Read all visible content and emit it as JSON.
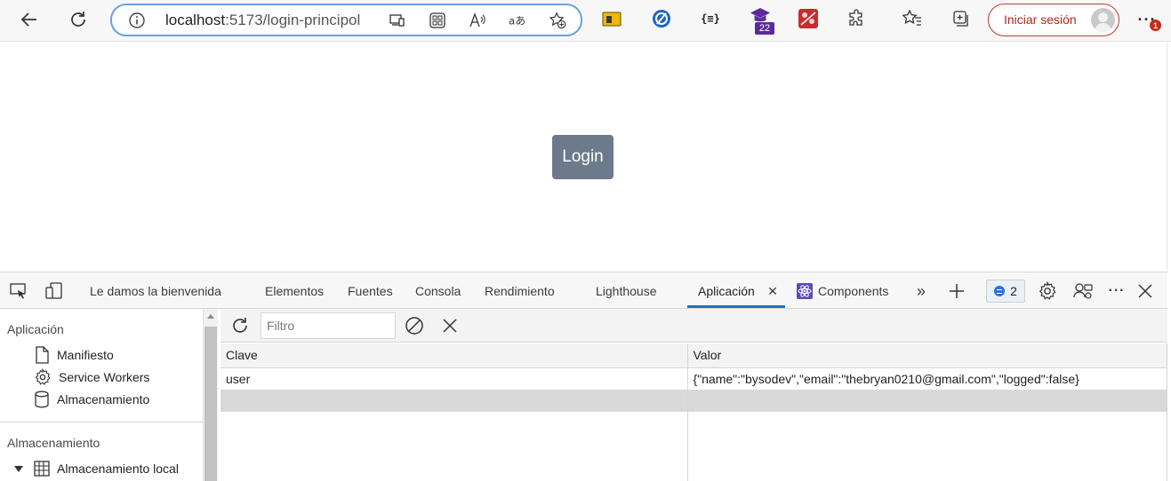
{
  "browser": {
    "url_host": "localhost",
    "url_path": ":5173/login-principol",
    "signin_label": "Iniciar sesión",
    "extension_badge": "22",
    "ext_json_label": "{≡}",
    "more_badge": "1",
    "colors": {
      "address_border": "#6a9fe2",
      "signin_accent": "#b3261e"
    },
    "icons": [
      "back-icon",
      "refresh-icon",
      "info-icon",
      "app-available-icon",
      "apps-icon",
      "read-aloud-icon",
      "translate-icon",
      "favorite-add-icon",
      "extensions-icon",
      "favorites-icon",
      "collections-icon",
      "more-icon"
    ]
  },
  "page": {
    "login_label": "Login",
    "login_color": "#6c7a8c"
  },
  "devtools": {
    "tabs": {
      "welcome": "Le damos la bienvenida",
      "elements": "Elementos",
      "sources": "Fuentes",
      "console": "Consola",
      "performance": "Rendimiento",
      "lighthouse": "Lighthouse",
      "application": "Aplicación",
      "components": "Components"
    },
    "issues_count": "2",
    "accent": "#1a73c8",
    "sidebar": {
      "section_app": "Aplicación",
      "manifest": "Manifiesto",
      "service_workers": "Service Workers",
      "storage": "Almacenamiento",
      "section_storage": "Almacenamiento",
      "local_storage": "Almacenamiento local"
    },
    "filter": {
      "placeholder": "Filtro",
      "value": ""
    },
    "table": {
      "headers": {
        "key": "Clave",
        "value": "Valor"
      },
      "rows": [
        {
          "key": "user",
          "value": "{\"name\":\"bysodev\",\"email\":\"thebryan0210@gmail.com\",\"logged\":false}"
        }
      ]
    }
  }
}
